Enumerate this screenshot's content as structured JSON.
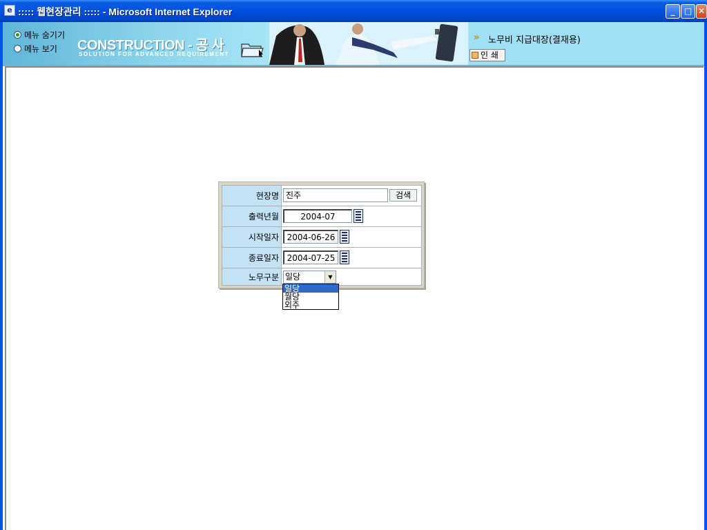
{
  "window": {
    "title": "::::: 웹현장관리 ::::: - Microsoft Internet Explorer",
    "icon": "ie-icon",
    "controls": [
      "minimize",
      "maximize",
      "close"
    ]
  },
  "banner": {
    "menu_options": [
      {
        "label": "메뉴 숨기기",
        "checked": true
      },
      {
        "label": "메뉴 보기",
        "checked": false
      }
    ],
    "brand": "CONSTRUCTION - 공 사",
    "brand_sub": "SOLUTION FOR ADVANCED REQUIREMENT",
    "page_title": "노무비 지급대장(결재용)",
    "print_label": "인 쇄"
  },
  "form": {
    "site": {
      "label": "현장명",
      "value": "진주",
      "search_label": "검색"
    },
    "output_month": {
      "label": "출력년월",
      "value": "2004-07"
    },
    "start_date": {
      "label": "시작일자",
      "value": "2004-06-26"
    },
    "end_date": {
      "label": "종료일자",
      "value": "2004-07-25"
    },
    "labor_type": {
      "label": "노무구분",
      "value": "일당",
      "options": [
        "일당",
        "월당",
        "외주"
      ],
      "highlighted": "일당"
    }
  },
  "colors": {
    "label_bg": "#c3e2f6",
    "banner_bg": "#9fe0f5",
    "selection": "#316ac5"
  }
}
